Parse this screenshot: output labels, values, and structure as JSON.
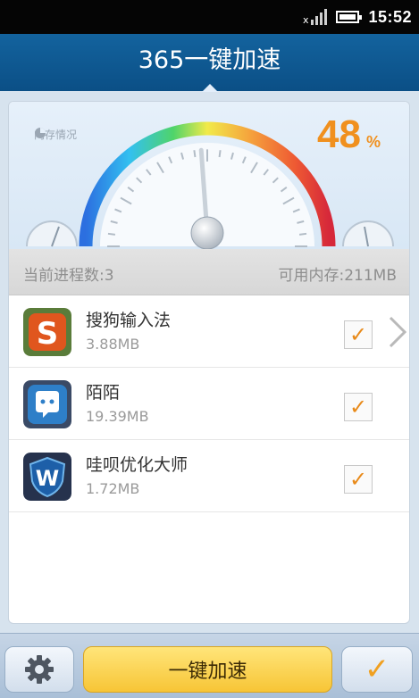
{
  "status_bar": {
    "time": "15:52",
    "signal_icon": "signal-icon",
    "battery_icon": "battery-icon"
  },
  "header": {
    "title": "365一键加速"
  },
  "memory": {
    "label": "内存情况",
    "percent": "48",
    "percent_unit": "%",
    "level": 0.48
  },
  "stats": {
    "processes": "当前进程数:3",
    "available": "可用内存:211MB"
  },
  "apps": [
    {
      "name": "搜狗输入法",
      "size": "3.88MB",
      "checked": "✓",
      "icon": "sogou-icon",
      "color": "#e0561e"
    },
    {
      "name": "陌陌",
      "size": "19.39MB",
      "checked": "✓",
      "icon": "momo-icon",
      "color": "#2e7fc8"
    },
    {
      "name": "哇呗优化大师",
      "size": "1.72MB",
      "checked": "✓",
      "icon": "wabei-shield-icon",
      "color": "#1d5fa8"
    }
  ],
  "toolbar": {
    "settings_icon": "gear-icon",
    "boost_label": "一键加速",
    "confirm_label": "✓"
  },
  "colors": {
    "accent": "#f0901e",
    "header": "#0b4f86"
  }
}
